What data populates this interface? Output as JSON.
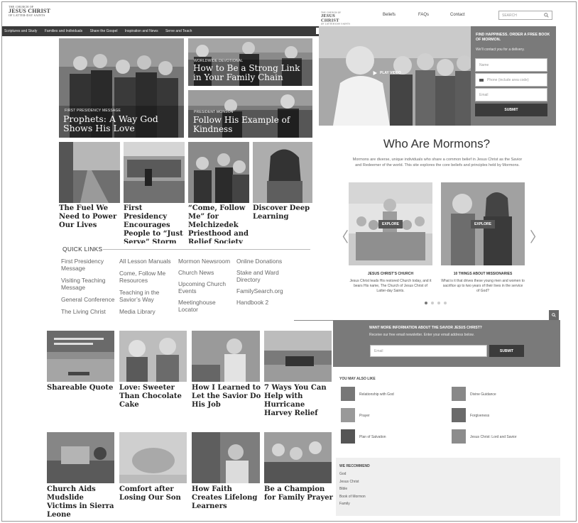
{
  "left_logo": {
    "small": "THE CHURCH OF",
    "big": "JESUS CHRIST",
    "sub": "OF LATTER-DAY SAINTS"
  },
  "left_nav": [
    "Scriptures and Study",
    "Families and Individuals",
    "Share the Gospel",
    "Inspiration and News",
    "Serve and Teach"
  ],
  "featured": [
    {
      "tag": "First Presidency Message",
      "title": "Prophets: A Way God Shows His Love"
    },
    {
      "tag": "Worldwide Devotional",
      "title": "How to Be a Strong Link in Your Family Chain"
    },
    {
      "tag": "President Monson",
      "title": "Follow His Example of Kindness"
    }
  ],
  "stories_row1": [
    "The Fuel We Need to Power Our Lives",
    "First Presidency Encourages People to “Just Serve” Storm Victims",
    "“Come, Follow Me” for Melchizedek Priesthood and Relief Society",
    "Discover Deep Learning"
  ],
  "quick_links": {
    "title": "QUICK LINKS",
    "col1": [
      "First Presidency Message",
      "Visiting Teaching Message",
      "General Conference",
      "The Living Christ"
    ],
    "col2": [
      "All Lesson Manuals",
      "Come, Follow Me Resources",
      "Teaching in the Savior’s Way",
      "Media Library"
    ],
    "col3": [
      "Mormon Newsroom",
      "Church News",
      "Upcoming Church Events",
      "Meetinghouse Locator"
    ],
    "col4": [
      "Online Donations",
      "Stake and Ward Directory",
      "FamilySearch.org",
      "Handbook 2"
    ]
  },
  "stories_row2": [
    "Shareable Quote",
    "Love: Sweeter Than Chocolate Cake",
    "How I Learned to Let the Savior Do His Job",
    "7 Ways You Can Help with Hurricane Harvey Relief"
  ],
  "stories_row3": [
    "Church Aids Mudslide Victims in Sierra Leone",
    "Comfort after Losing Our Son",
    "How Faith Creates Lifelong Learners",
    "Be a Champion for Family Prayer"
  ],
  "right_logo": {
    "small": "THE CHURCH OF",
    "big": "JESUS CHRIST",
    "sub": "OF LATTER-DAY SAINTS"
  },
  "right_nav": [
    "Beliefs",
    "FAQs",
    "Contact"
  ],
  "search": {
    "placeholder": "SEARCH"
  },
  "hero": {
    "play_label": "PLAY VIDEO",
    "form_title": "FIND HAPPINESS. ORDER A FREE BOOK OF MORMON.",
    "form_sub": "We’ll contact you for a delivery.",
    "name_ph": "Name",
    "phone_ph": "Phone (include area code)",
    "email_ph": "Email",
    "submit": "SUBMIT"
  },
  "who": {
    "title": "Who Are Mormons?",
    "desc": "Mormons are diverse, unique individuals who share a common belief in Jesus Christ as the Savior and Redeemer of the world. This site explores the core beliefs and principles held by Mormons."
  },
  "carousel": [
    {
      "btn": "EXPLORE",
      "title": "JESUS CHRIST’S CHURCH",
      "text": "Jesus Christ leads His restored Church today, and it bears His name, The Church of Jesus Christ of Latter-day Saints."
    },
    {
      "btn": "EXPLORE",
      "title": "10 THINGS ABOUT MISSIONARIES",
      "text": "What is it that drives these young men and women to sacrifice up to two years of their lives in the service of God?"
    }
  ],
  "carousel_arrows": {
    "prev": "〈",
    "next": "〉"
  },
  "newsletter": {
    "title": "WANT MORE INFORMATION ABOUT THE SAVIOR JESUS CHRIST?",
    "sub": "Receive our free email newsletter. Enter your email address below.",
    "email_ph": "Email",
    "submit": "SUBMIT"
  },
  "also_like": {
    "title": "YOU MAY ALSO LIKE",
    "items": [
      "Relationship with God",
      "Divine Guidance",
      "Prayer",
      "Forgiveness",
      "Plan of Salvation",
      "Jesus Christ: Lord and Savior"
    ]
  },
  "recommend": {
    "title": "WE RECOMMEND",
    "items": [
      "God",
      "Jesus Christ",
      "Bible",
      "Book of Mormon",
      "Family"
    ]
  },
  "colors": {
    "dark": "#3b3b3b",
    "panel": "#7a7a7a",
    "light_panel": "#efefef"
  }
}
